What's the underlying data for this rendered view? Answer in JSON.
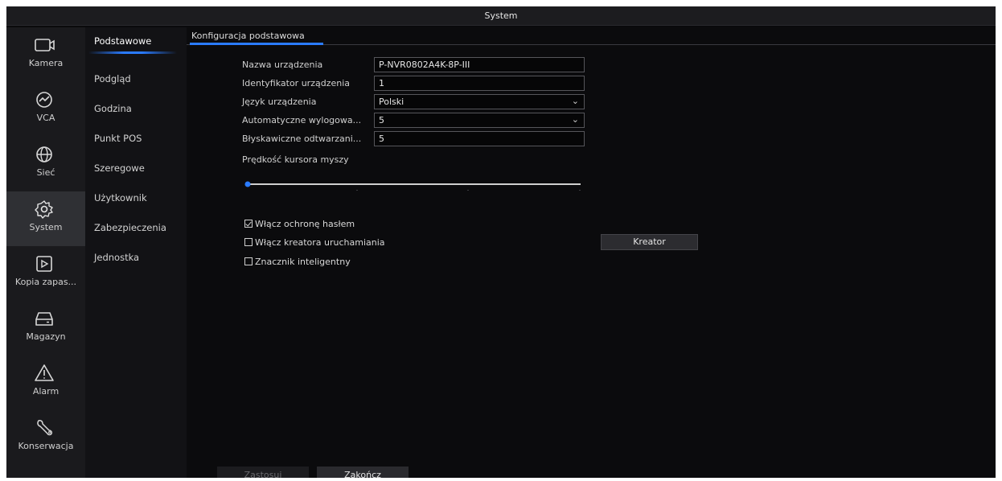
{
  "window": {
    "title": "System"
  },
  "left_nav": [
    {
      "label": "Kamera",
      "icon": "camera-icon",
      "active": false
    },
    {
      "label": "VCA",
      "icon": "vca-icon",
      "active": false
    },
    {
      "label": "Sieć",
      "icon": "globe-icon",
      "active": false
    },
    {
      "label": "System",
      "icon": "gear-icon",
      "active": true
    },
    {
      "label": "Kopia zapas...",
      "icon": "backup-icon",
      "active": false
    },
    {
      "label": "Magazyn",
      "icon": "storage-icon",
      "active": false
    },
    {
      "label": "Alarm",
      "icon": "alarm-icon",
      "active": false
    },
    {
      "label": "Konserwacja",
      "icon": "wrench-icon",
      "active": false
    }
  ],
  "sub_nav": [
    {
      "label": "Podstawowe",
      "active": true
    },
    {
      "label": "Podgląd",
      "active": false
    },
    {
      "label": "Godzina",
      "active": false
    },
    {
      "label": "Punkt POS",
      "active": false
    },
    {
      "label": "Szeregowe",
      "active": false
    },
    {
      "label": "Użytkownik",
      "active": false
    },
    {
      "label": "Zabezpieczenia",
      "active": false
    },
    {
      "label": "Jednostka",
      "active": false
    }
  ],
  "tab": {
    "label": "Konfiguracja podstawowa"
  },
  "form": {
    "device_name": {
      "label": "Nazwa urządzenia",
      "value": "P-NVR0802A4K-8P-III"
    },
    "device_id": {
      "label": "Identyfikator urządzenia",
      "value": "1"
    },
    "language": {
      "label": "Język urządzenia",
      "value": "Polski"
    },
    "auto_logout": {
      "label": "Automatyczne wylogowa...",
      "value": "5"
    },
    "instant_playback": {
      "label": "Błyskawiczne odtwarzani...",
      "value": "5"
    },
    "mouse_speed": {
      "label": "Prędkość kursora myszy",
      "value_fraction": 0.0
    }
  },
  "checkboxes": {
    "password_protection": {
      "label": "Włącz ochronę hasłem",
      "checked": true
    },
    "startup_wizard": {
      "label": "Włącz kreatora uruchamiania",
      "checked": false
    },
    "smart_marker": {
      "label": "Znacznik inteligentny",
      "checked": false
    }
  },
  "buttons": {
    "wizard": "Kreator",
    "apply": "Zastosuj",
    "exit": "Zakończ"
  },
  "colors": {
    "accent": "#2a7bff",
    "background": "#0b0b0d"
  }
}
